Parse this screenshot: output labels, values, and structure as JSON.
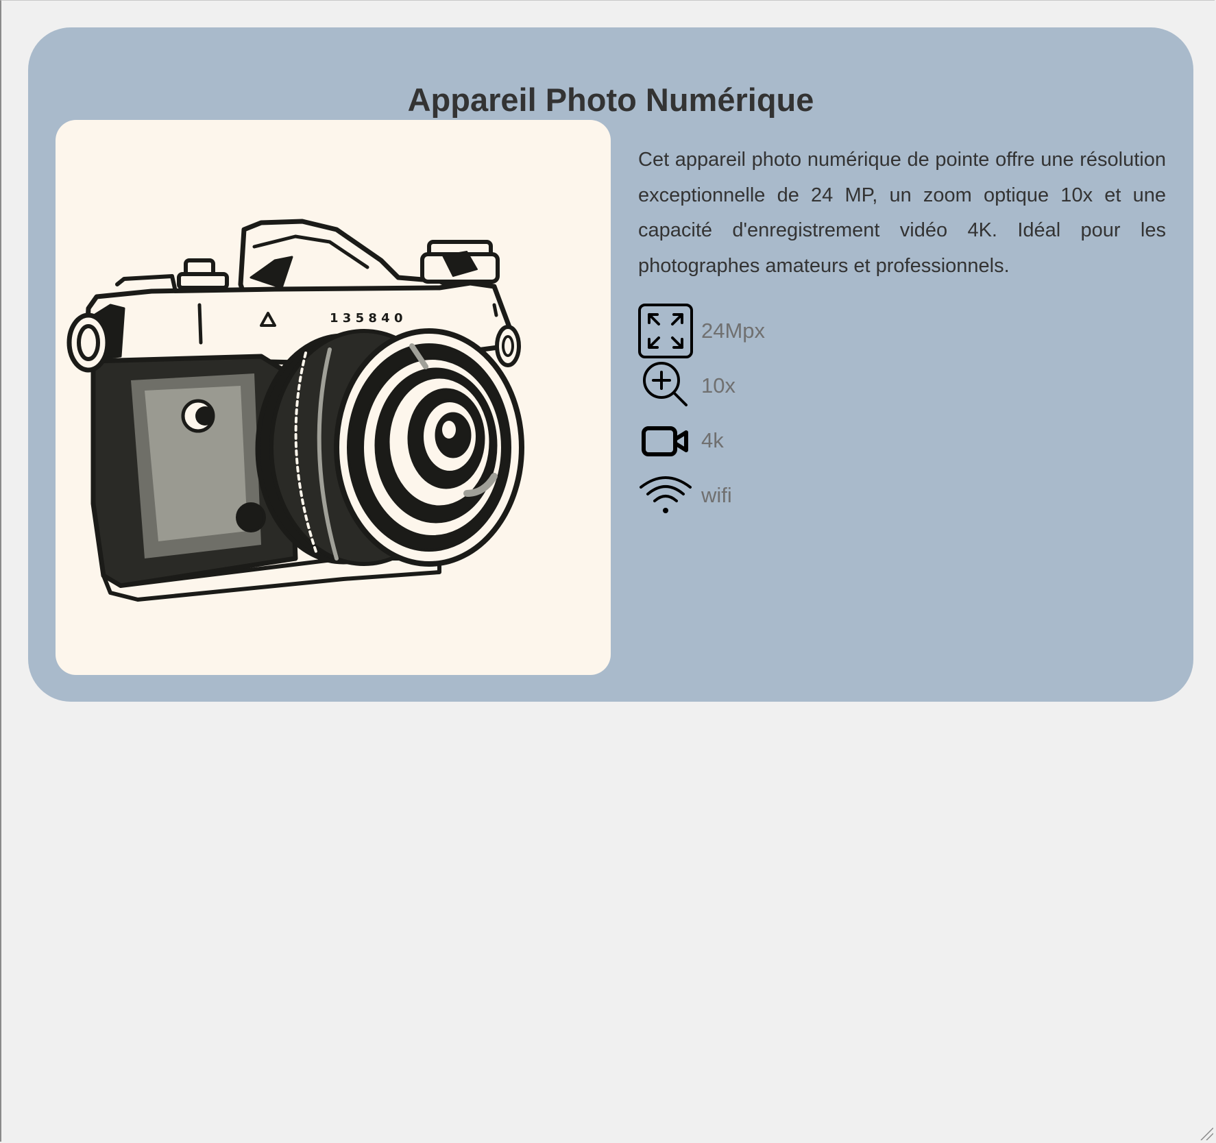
{
  "product": {
    "title": "Appareil Photo Numérique",
    "image_icon": "camera-illustration",
    "description": "Cet appareil photo numérique de pointe offre une résolution exceptionnelle de 24 MP, un zoom optique 10x et une capacité d'enregistrement vidéo 4K. Idéal pour les photographes amateurs et professionnels.",
    "features": [
      {
        "icon": "expand-icon",
        "label": "24Mpx"
      },
      {
        "icon": "zoom-in-icon",
        "label": "10x"
      },
      {
        "icon": "video-camera-icon",
        "label": "4k"
      },
      {
        "icon": "wifi-icon",
        "label": "wifi"
      }
    ]
  },
  "colors": {
    "page_background": "#f0f0f0",
    "card_background": "#a9bacb",
    "image_background": "#fdf6ec",
    "title_text": "#333333",
    "feature_text": "#707070"
  }
}
